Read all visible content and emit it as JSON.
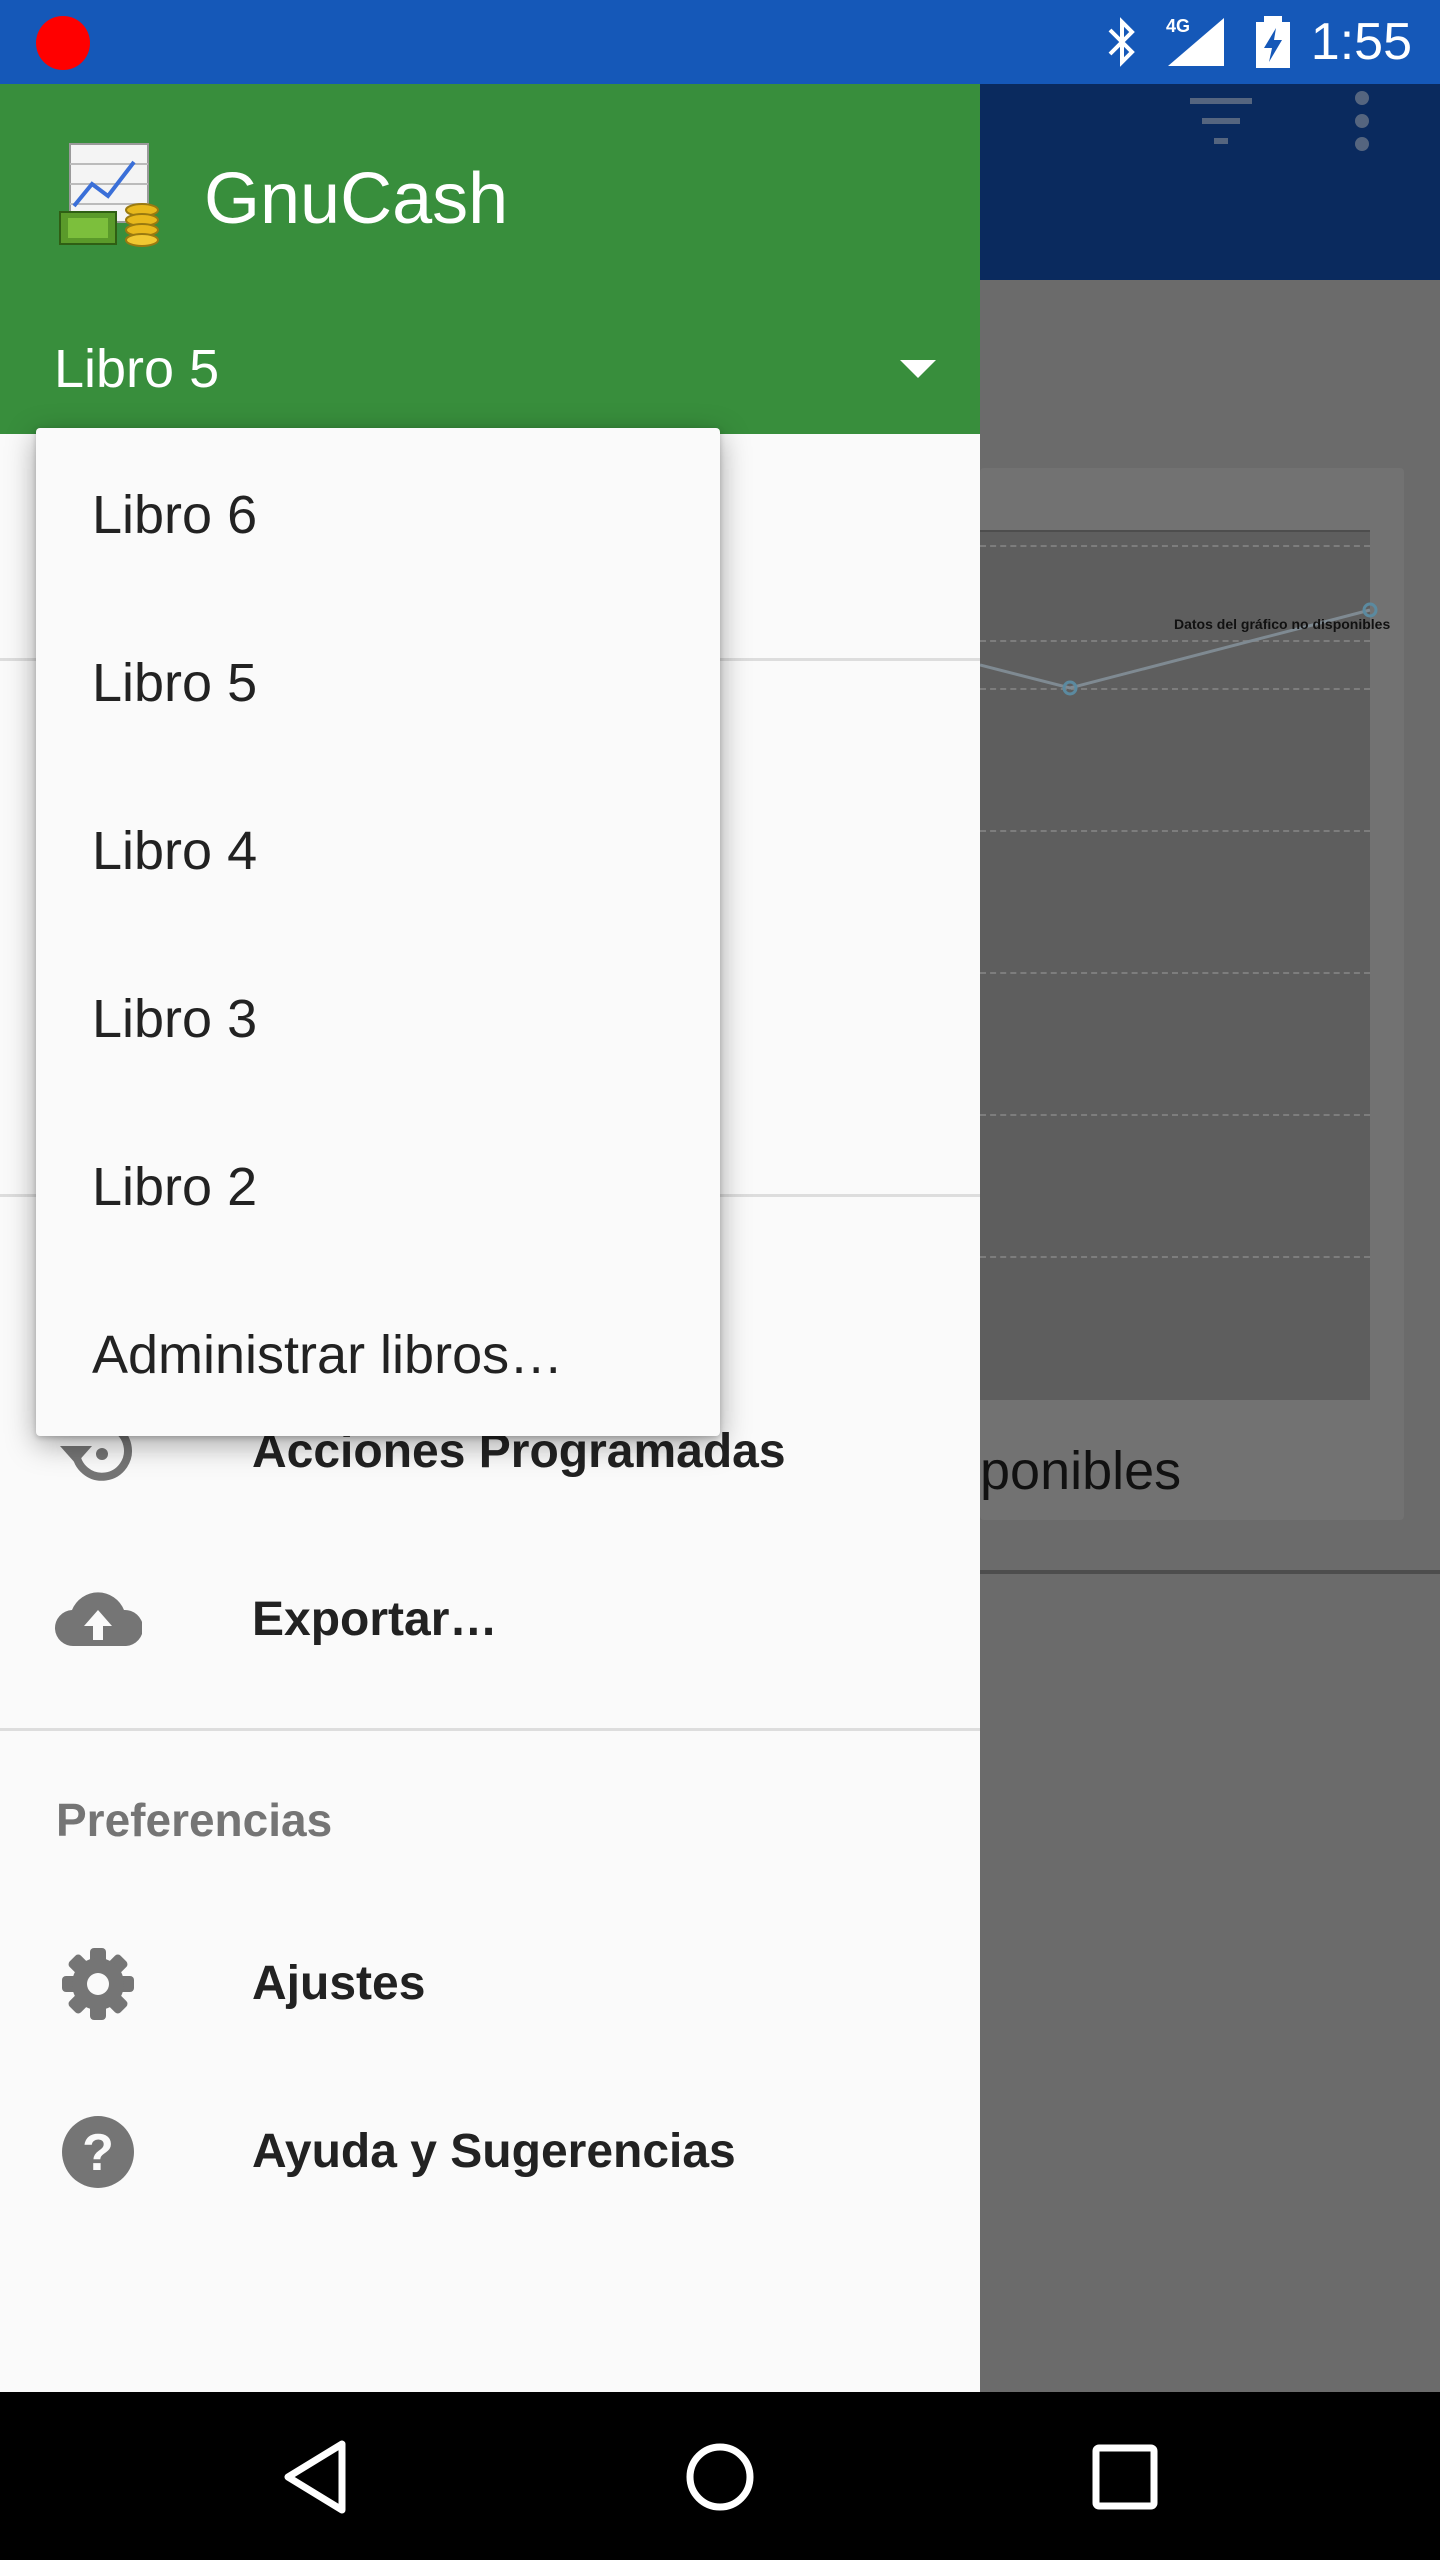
{
  "status_bar": {
    "time": "1:55",
    "network": "4G",
    "icons": [
      "recording-dot",
      "bluetooth-icon",
      "signal-icon",
      "battery-charging-icon"
    ]
  },
  "background_screen": {
    "toolbar_icons": [
      "filter-icon",
      "overflow-menu-icon"
    ],
    "chart_message": "Datos del gráfico no disponibles",
    "card_text": "ponibles"
  },
  "drawer": {
    "app_title": "GnuCash",
    "selected_book": "Libro 5",
    "items": [
      {
        "label": "Acciones Programadas",
        "icon": "scheduled-history-icon"
      },
      {
        "label": "Exportar…",
        "icon": "cloud-upload-icon"
      }
    ],
    "preferences_header": "Preferencias",
    "pref_items": [
      {
        "label": "Ajustes",
        "icon": "gear-icon"
      },
      {
        "label": "Ayuda y Sugerencias",
        "icon": "help-icon"
      }
    ]
  },
  "books_menu": {
    "items": [
      "Libro 6",
      "Libro 5",
      "Libro 4",
      "Libro 3",
      "Libro 2",
      "Administrar libros…"
    ]
  },
  "colors": {
    "status_bar": "#1558b8",
    "drawer_header": "#388e3c",
    "drawer_bg": "#fafafa"
  }
}
